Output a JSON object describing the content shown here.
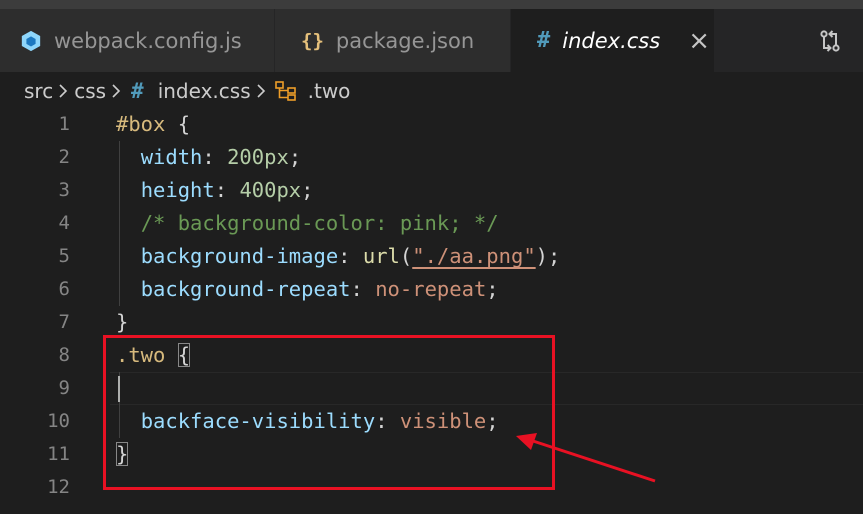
{
  "tabs": [
    {
      "label": "webpack.config.js",
      "icon": "webpack-icon",
      "active": false
    },
    {
      "label": "package.json",
      "icon": "braces-icon",
      "icon_text": "{}",
      "active": false
    },
    {
      "label": "index.css",
      "icon": "hash-icon",
      "icon_text": "#",
      "active": true
    }
  ],
  "tab_close_glyph": "×",
  "breadcrumb": {
    "items": [
      "src",
      "css",
      "index.css",
      ".two"
    ],
    "file_icon_text": "#"
  },
  "editor": {
    "lines": [
      {
        "n": "1",
        "tokens": [
          [
            "sel",
            "#box"
          ],
          [
            "pun",
            " {"
          ]
        ]
      },
      {
        "n": "2",
        "tokens": [
          [
            "pun",
            "  "
          ],
          [
            "prop",
            "width"
          ],
          [
            "pun",
            ": "
          ],
          [
            "num",
            "200px"
          ],
          [
            "pun",
            ";"
          ]
        ]
      },
      {
        "n": "3",
        "tokens": [
          [
            "pun",
            "  "
          ],
          [
            "prop",
            "height"
          ],
          [
            "pun",
            ": "
          ],
          [
            "num",
            "400px"
          ],
          [
            "pun",
            ";"
          ]
        ]
      },
      {
        "n": "4",
        "tokens": [
          [
            "pun",
            "  "
          ],
          [
            "com",
            "/* background-color: pink; */"
          ]
        ]
      },
      {
        "n": "5",
        "tokens": [
          [
            "pun",
            "  "
          ],
          [
            "prop",
            "background-image"
          ],
          [
            "pun",
            ": "
          ],
          [
            "fn",
            "url"
          ],
          [
            "pun",
            "("
          ],
          [
            "str",
            "\"./aa.png\""
          ],
          [
            "pun",
            ");"
          ]
        ]
      },
      {
        "n": "6",
        "tokens": [
          [
            "pun",
            "  "
          ],
          [
            "prop",
            "background-repeat"
          ],
          [
            "pun",
            ": "
          ],
          [
            "val",
            "no-repeat"
          ],
          [
            "pun",
            ";"
          ]
        ]
      },
      {
        "n": "7",
        "tokens": [
          [
            "pun",
            "}"
          ]
        ]
      },
      {
        "n": "8",
        "tokens": [
          [
            "sel",
            ".two"
          ],
          [
            "pun",
            " "
          ],
          [
            "bm",
            "{"
          ]
        ]
      },
      {
        "n": "9",
        "tokens": []
      },
      {
        "n": "10",
        "tokens": [
          [
            "pun",
            "  "
          ],
          [
            "prop",
            "backface-visibility"
          ],
          [
            "pun",
            ": "
          ],
          [
            "val",
            "visible"
          ],
          [
            "pun",
            ";"
          ]
        ]
      },
      {
        "n": "11",
        "tokens": [
          [
            "bm",
            "}"
          ]
        ]
      },
      {
        "n": "12",
        "tokens": []
      }
    ]
  },
  "colors": {
    "annotation": "#e81123",
    "editor_bg": "#1e1e1e"
  }
}
